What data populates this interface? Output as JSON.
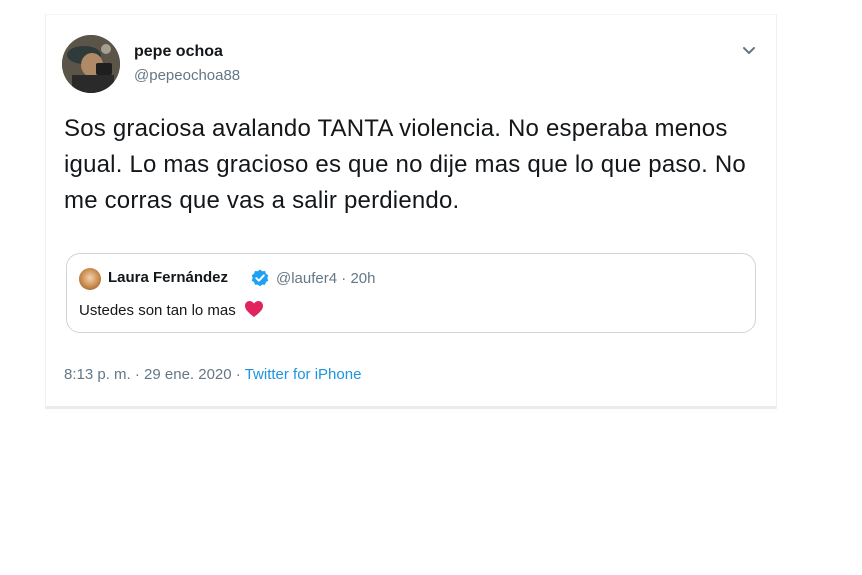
{
  "tweet": {
    "author": {
      "display_name": "pepe ochoa",
      "handle": "@pepeochoa88"
    },
    "text": "Sos graciosa avalando TANTA violencia. No esperaba menos igual. Lo mas gracioso es que no dije mas que lo que paso. No me corras que vas a salir perdiendo.",
    "menu_icon": "chevron-down-icon",
    "quoted": {
      "display_name": "Laura Fernández",
      "verified_icon": "verified-badge-icon",
      "handle": "@laufer4",
      "separator": "·",
      "age": "20h",
      "text": "Ustedes son tan lo mas",
      "emoji": "red-heart-icon"
    },
    "timestamp": "8:13 p. m. · 29 ene. 2020",
    "meta_separator": "·",
    "source": "Twitter for iPhone"
  },
  "colors": {
    "text_primary": "#14171a",
    "text_secondary": "#657786",
    "link": "#1b95e0",
    "verified": "#1da1f2",
    "heart": "#e0245e",
    "border": "#ccd6dd"
  }
}
